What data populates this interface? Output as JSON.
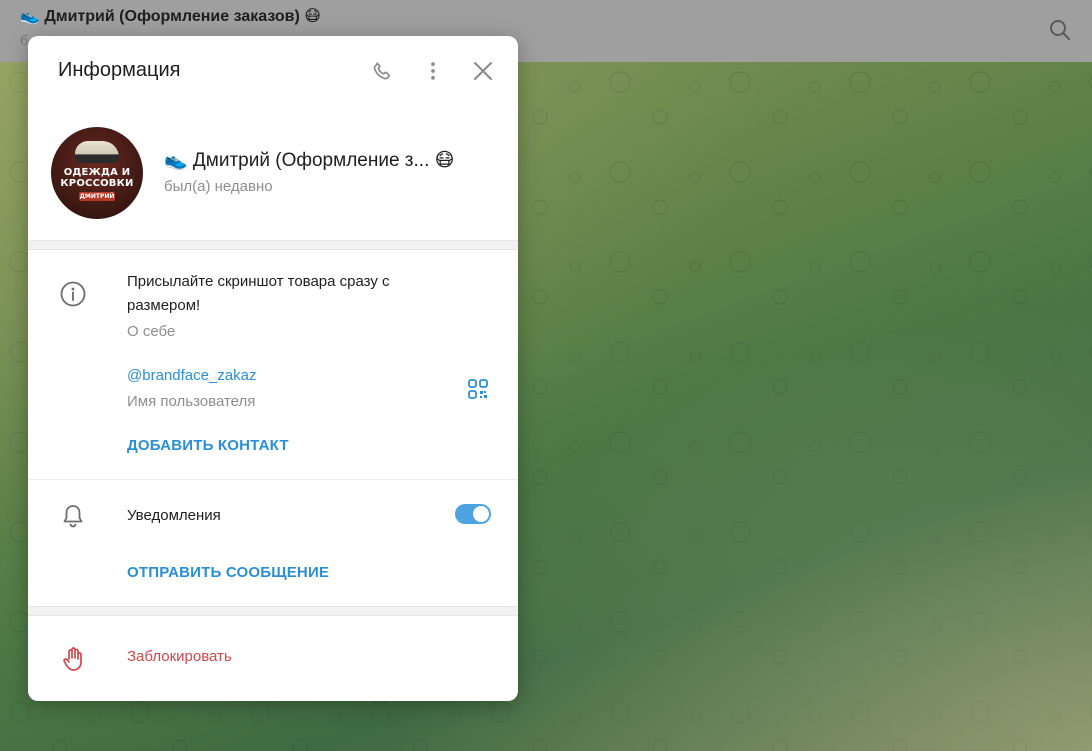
{
  "chat_header": {
    "title": "👟 Дмитрий (Оформление заказов) 😷",
    "subtitle": "б..."
  },
  "panel": {
    "title": "Информация",
    "profile": {
      "name": "👟 Дмитрий (Оформление з... 😷",
      "status": "был(а) недавно",
      "avatar_line1": "ОДЕЖДА И",
      "avatar_line2": "КРОССОВКИ",
      "avatar_tag": "ДМИТРИЙ"
    },
    "bio": {
      "text_line1": "Присылайте скриншот товара сразу с",
      "text_line2": "размером!",
      "caption": "О себе"
    },
    "username": {
      "value": "@brandface_zakaz",
      "caption": "Имя пользователя"
    },
    "add_contact_label": "ДОБАВИТЬ КОНТАКТ",
    "notifications": {
      "label": "Уведомления",
      "enabled": true
    },
    "send_message_label": "ОТПРАВИТЬ СООБЩЕНИЕ",
    "block_label": "Заблокировать"
  },
  "colors": {
    "accent": "#2b8fd6",
    "danger": "#d0474b",
    "toggle_on": "#4ea4e0"
  },
  "icons": [
    "search-icon",
    "phone-icon",
    "more-vertical-icon",
    "close-icon",
    "info-icon",
    "qr-code-icon",
    "bell-icon",
    "hand-block-icon"
  ]
}
